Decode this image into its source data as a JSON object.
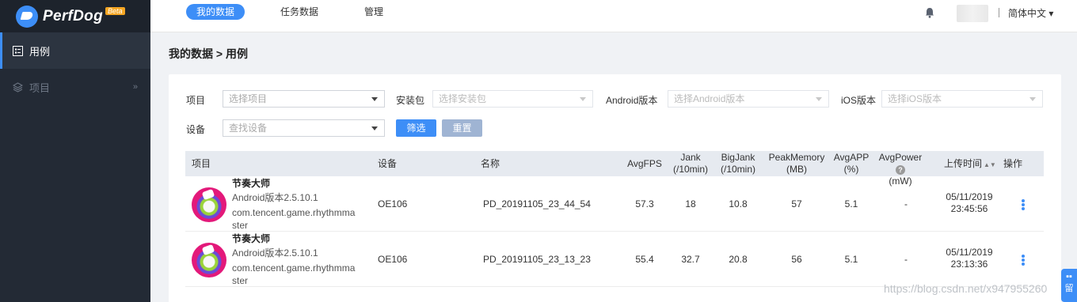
{
  "brand": {
    "name": "PerfDog",
    "badge": "Beta"
  },
  "sidebar": {
    "items": [
      {
        "label": "用例",
        "icon": "list-icon",
        "active": true
      },
      {
        "label": "项目",
        "icon": "layers-icon",
        "active": false,
        "arrow": "»"
      }
    ]
  },
  "topnav": {
    "tabs": [
      {
        "label": "我的数据",
        "active": true
      },
      {
        "label": "任务数据",
        "active": false
      },
      {
        "label": "管理",
        "active": false
      }
    ],
    "language": "简体中文 ▾"
  },
  "breadcrumb": "我的数据 > 用例",
  "filters": {
    "project": {
      "label": "项目",
      "placeholder": "选择项目"
    },
    "package": {
      "label": "安装包",
      "placeholder": "选择安装包"
    },
    "android": {
      "label": "Android版本",
      "placeholder": "选择Android版本"
    },
    "ios": {
      "label": "iOS版本",
      "placeholder": "选择iOS版本"
    },
    "device": {
      "label": "设备",
      "placeholder": "查找设备"
    },
    "filter_button": "筛选",
    "reset_button": "重置"
  },
  "table": {
    "headers": {
      "project": "项目",
      "device": "设备",
      "name": "名称",
      "avgfps": "AvgFPS",
      "jank": [
        "Jank",
        "(/10min)"
      ],
      "bigjank": [
        "BigJank",
        "(/10min)"
      ],
      "peakmem": [
        "PeakMemory",
        "(MB)"
      ],
      "avgapp": [
        "AvgAPP",
        "(%)"
      ],
      "avgpower": [
        "AvgPower",
        "(mW)"
      ],
      "help": "?",
      "upload": "上传时间",
      "sort": "▲▼",
      "ops": "操作"
    },
    "rows": [
      {
        "app": "节奏大师",
        "version": "Android版本2.5.10.1",
        "package_1": "com.tencent.game.rhythmma",
        "package_2": "ster",
        "device": "OE106",
        "name": "PD_20191105_23_44_54",
        "avgfps": "57.3",
        "jank": "18",
        "bigjank": "10.8",
        "peakmem": "57",
        "avgapp": "5.1",
        "avgpower": "-",
        "date": "05/11/2019",
        "time": "23:45:56"
      },
      {
        "app": "节奏大师",
        "version": "Android版本2.5.10.1",
        "package_1": "com.tencent.game.rhythmma",
        "package_2": "ster",
        "device": "OE106",
        "name": "PD_20191105_23_13_23",
        "avgfps": "55.4",
        "jank": "32.7",
        "bigjank": "20.8",
        "peakmem": "56",
        "avgapp": "5.1",
        "avgpower": "-",
        "date": "05/11/2019",
        "time": "23:13:36"
      }
    ]
  },
  "watermark": "https://blog.csdn.net/x947955260",
  "float_button": "留",
  "colors": {
    "accent": "#3d8ef7",
    "sidebar": "#232a35"
  }
}
